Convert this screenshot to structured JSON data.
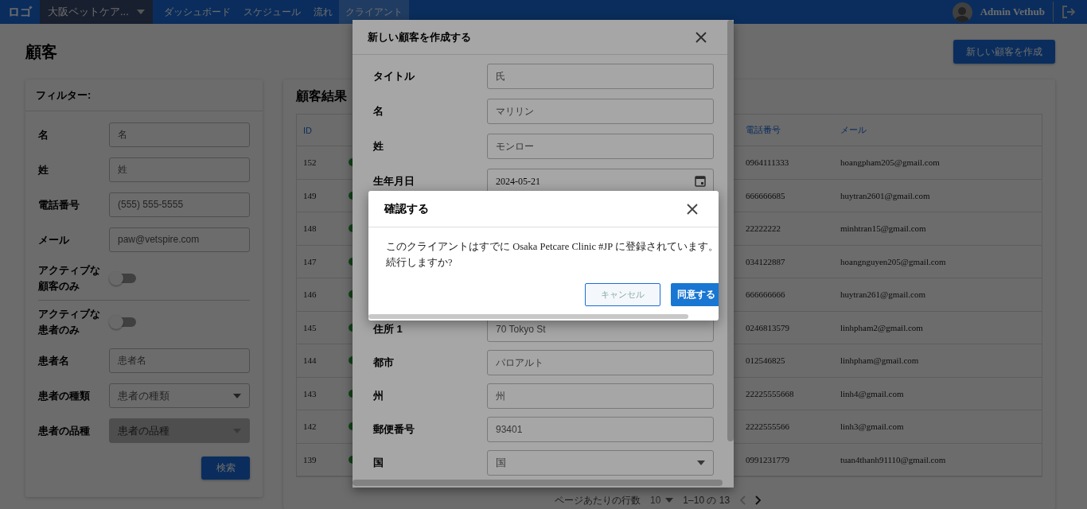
{
  "navbar": {
    "logo": "ロゴ",
    "clinic_select": "大阪ペットケア...",
    "links": [
      {
        "label": "ダッシュボード",
        "selected": false
      },
      {
        "label": "スケジュール",
        "selected": false
      },
      {
        "label": "流れ",
        "selected": false
      },
      {
        "label": "クライアント",
        "selected": true
      }
    ],
    "user": "Admin Vethub"
  },
  "page_title": "顧客",
  "create_button": "新しい顧客を作成",
  "filters": {
    "title": "フィルター:",
    "items": [
      {
        "kind": "input",
        "label": "名",
        "placeholder": "名"
      },
      {
        "kind": "input",
        "label": "姓",
        "placeholder": "姓"
      },
      {
        "kind": "input",
        "label": "電話番号",
        "placeholder": "(555) 555-5555"
      },
      {
        "kind": "input",
        "label": "メール",
        "placeholder": "paw@vetspire.com"
      },
      {
        "kind": "switch",
        "label": "アクティブな顧客のみ",
        "on": false
      },
      {
        "kind": "switch",
        "label": "アクティブな患者のみ",
        "on": false
      },
      {
        "kind": "input",
        "label": "患者名",
        "placeholder": "患者名"
      },
      {
        "kind": "select",
        "label": "患者の種類",
        "placeholder": "患者の種類",
        "disabled": false
      },
      {
        "kind": "select",
        "label": "患者の品種",
        "placeholder": "患者の品種",
        "disabled": true
      }
    ],
    "search_button": "検索"
  },
  "results": {
    "title": "顧客結果",
    "columns": [
      "ID",
      "電話番号",
      "メール"
    ],
    "rows": [
      {
        "id": "152",
        "active": true,
        "phone": "0964111333",
        "email": "hoangpham205@gmail.com"
      },
      {
        "id": "149",
        "active": true,
        "phone": "666666685",
        "email": "huytran2601@gmail.com"
      },
      {
        "id": "148",
        "active": true,
        "phone": "22222222",
        "email": "minhtran15@gmail.com"
      },
      {
        "id": "147",
        "active": true,
        "phone": "034122887",
        "email": "hoangnguyen205@gmail.com"
      },
      {
        "id": "146",
        "active": true,
        "phone": "666666666",
        "email": "huytran261@gmail.com"
      },
      {
        "id": "145",
        "active": true,
        "phone": "0246813579",
        "email": "linhpham2@gmail.com"
      },
      {
        "id": "144",
        "active": true,
        "phone": "012546825",
        "email": "linhpham@gmail.com"
      },
      {
        "id": "143",
        "active": true,
        "phone": "22225555668",
        "email": "linh4@gmail.com"
      },
      {
        "id": "142",
        "active": true,
        "phone": "2222555566",
        "email": "linh3@gmail.com"
      },
      {
        "id": "139",
        "active": true,
        "phone": "0991231779",
        "email": "tuan4thanh91110@gmail.com"
      }
    ],
    "pagination": {
      "rows_label": "ページあたりの行数",
      "rows_value": "10",
      "range": "1–10 の 13"
    }
  },
  "create_modal": {
    "title": "新しい顧客を作成する",
    "fields_top": [
      {
        "kind": "input",
        "label": "タイトル",
        "placeholder": "氏"
      },
      {
        "kind": "input",
        "label": "名",
        "placeholder": "マリリン"
      },
      {
        "kind": "input",
        "label": "姓",
        "placeholder": "モンロー"
      },
      {
        "kind": "date",
        "label": "生年月日",
        "value": "2024-05-21"
      }
    ],
    "fields_bottom": [
      {
        "kind": "input",
        "label": "住所 1",
        "placeholder": "70 Tokyo St"
      },
      {
        "kind": "input",
        "label": "都市",
        "placeholder": "パロアルト"
      },
      {
        "kind": "input",
        "label": "州",
        "placeholder": "州"
      },
      {
        "kind": "input",
        "label": "郵便番号",
        "placeholder": "93401"
      },
      {
        "kind": "select",
        "label": "国",
        "placeholder": "国"
      }
    ]
  },
  "confirm_dialog": {
    "title": "確認する",
    "message": "このクライアントはすでに Osaka Petcare Clinic #JP に登録されています。続行しますか?",
    "cancel": "キャンセル",
    "confirm": "同意する"
  }
}
